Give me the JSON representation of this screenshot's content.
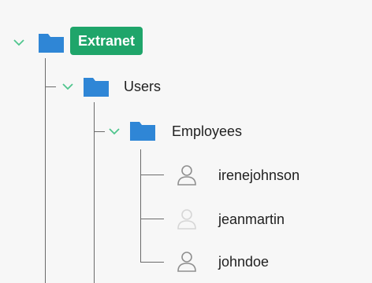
{
  "tree": {
    "root": {
      "label": "Extranet",
      "expanded": true,
      "selected": true,
      "icon": "folder-icon",
      "children": [
        {
          "label": "Users",
          "expanded": true,
          "icon": "folder-icon",
          "children": [
            {
              "label": "Employees",
              "expanded": true,
              "icon": "folder-icon",
              "children": [
                {
                  "label": "irenejohnson",
                  "icon": "user-icon",
                  "state": "normal"
                },
                {
                  "label": "jeanmartin",
                  "icon": "user-icon",
                  "state": "disabled"
                },
                {
                  "label": "johndoe",
                  "icon": "user-icon",
                  "state": "normal"
                }
              ]
            }
          ]
        }
      ]
    },
    "colors": {
      "selected_background": "#1fa56a",
      "folder": "#2f86d6",
      "chevron": "#4fc58d",
      "guide_line": "#6b6b6b",
      "user_icon": "#8f8f8f",
      "user_icon_disabled": "#d6d6d6"
    }
  }
}
